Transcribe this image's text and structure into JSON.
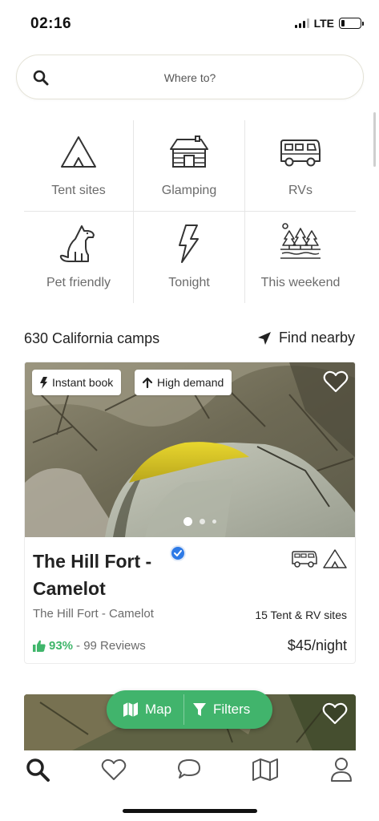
{
  "status_bar": {
    "time": "02:16",
    "network": "LTE"
  },
  "search": {
    "placeholder": "Where to?"
  },
  "categories": [
    {
      "label": "Tent sites",
      "icon": "tent-icon"
    },
    {
      "label": "Glamping",
      "icon": "cabin-icon"
    },
    {
      "label": "RVs",
      "icon": "rv-icon"
    },
    {
      "label": "Pet friendly",
      "icon": "dog-icon"
    },
    {
      "label": "Tonight",
      "icon": "lightning-icon"
    },
    {
      "label": "This weekend",
      "icon": "forest-icon"
    }
  ],
  "results": {
    "count_label": "630 California camps",
    "find_nearby_label": "Find nearby"
  },
  "listing": {
    "badges": [
      "Instant book",
      "High demand"
    ],
    "title": "The Hill Fort - Camelot",
    "subtitle": "The Hill Fort - Camelot",
    "sites": "15 Tent & RV sites",
    "rating_percent": "93%",
    "reviews": "- 99 Reviews",
    "price": "$45/night",
    "photo_count": 3,
    "active_photo": 1
  },
  "fab": {
    "map_label": "Map",
    "filters_label": "Filters"
  },
  "tabs": [
    "search-icon",
    "heart-icon",
    "chat-icon",
    "map-icon",
    "profile-icon"
  ],
  "colors": {
    "accent": "#41b46c",
    "rating_green": "#40b66b",
    "verified_blue": "#2e7ae6"
  }
}
